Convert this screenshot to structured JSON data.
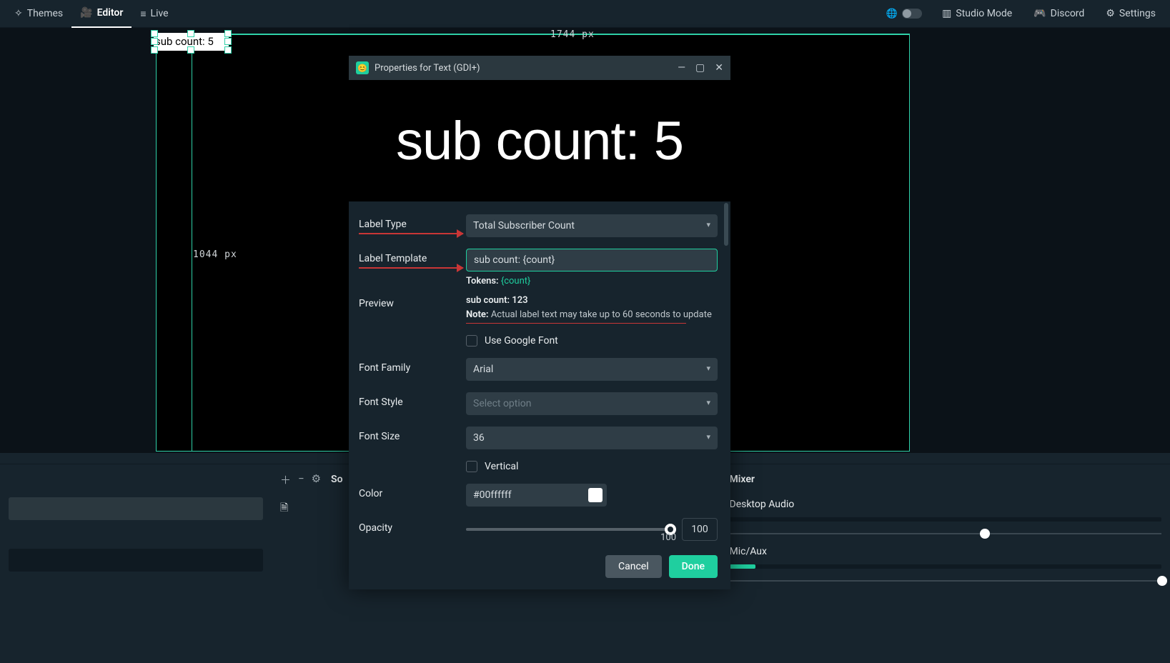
{
  "nav": {
    "themes": "Themes",
    "editor": "Editor",
    "live": "Live",
    "studio_mode": "Studio Mode",
    "discord": "Discord",
    "settings": "Settings"
  },
  "canvas": {
    "width_label": "1744 px",
    "height_label": "1044 px",
    "selected_source_text": "sub count: 5"
  },
  "dialog": {
    "title": "Properties for Text (GDI+)",
    "preview_render": "sub count: 5",
    "fields": {
      "label_type": {
        "label": "Label Type",
        "value": "Total Subscriber Count"
      },
      "label_template": {
        "label": "Label Template",
        "value": "sub count: {count}"
      },
      "tokens_prefix": "Tokens:",
      "tokens_value": "{count}",
      "preview": {
        "label": "Preview",
        "value": "sub count: 123",
        "note_prefix": "Note:",
        "note_text": " Actual label text may take up to 60 seconds to update"
      },
      "google_font": {
        "label": "Use Google Font"
      },
      "font_family": {
        "label": "Font Family",
        "value": "Arial"
      },
      "font_style": {
        "label": "Font Style",
        "placeholder": "Select option"
      },
      "font_size": {
        "label": "Font Size",
        "value": "36"
      },
      "vertical": {
        "label": "Vertical"
      },
      "color": {
        "label": "Color",
        "value": "#00ffffff"
      },
      "opacity": {
        "label": "Opacity",
        "value": "100",
        "max": "100"
      }
    },
    "buttons": {
      "cancel": "Cancel",
      "done": "Done"
    }
  },
  "dock": {
    "sources_title": "So",
    "mixer": {
      "title": "Mixer",
      "ch1": "Desktop Audio",
      "ch2": "Mic/Aux"
    }
  }
}
